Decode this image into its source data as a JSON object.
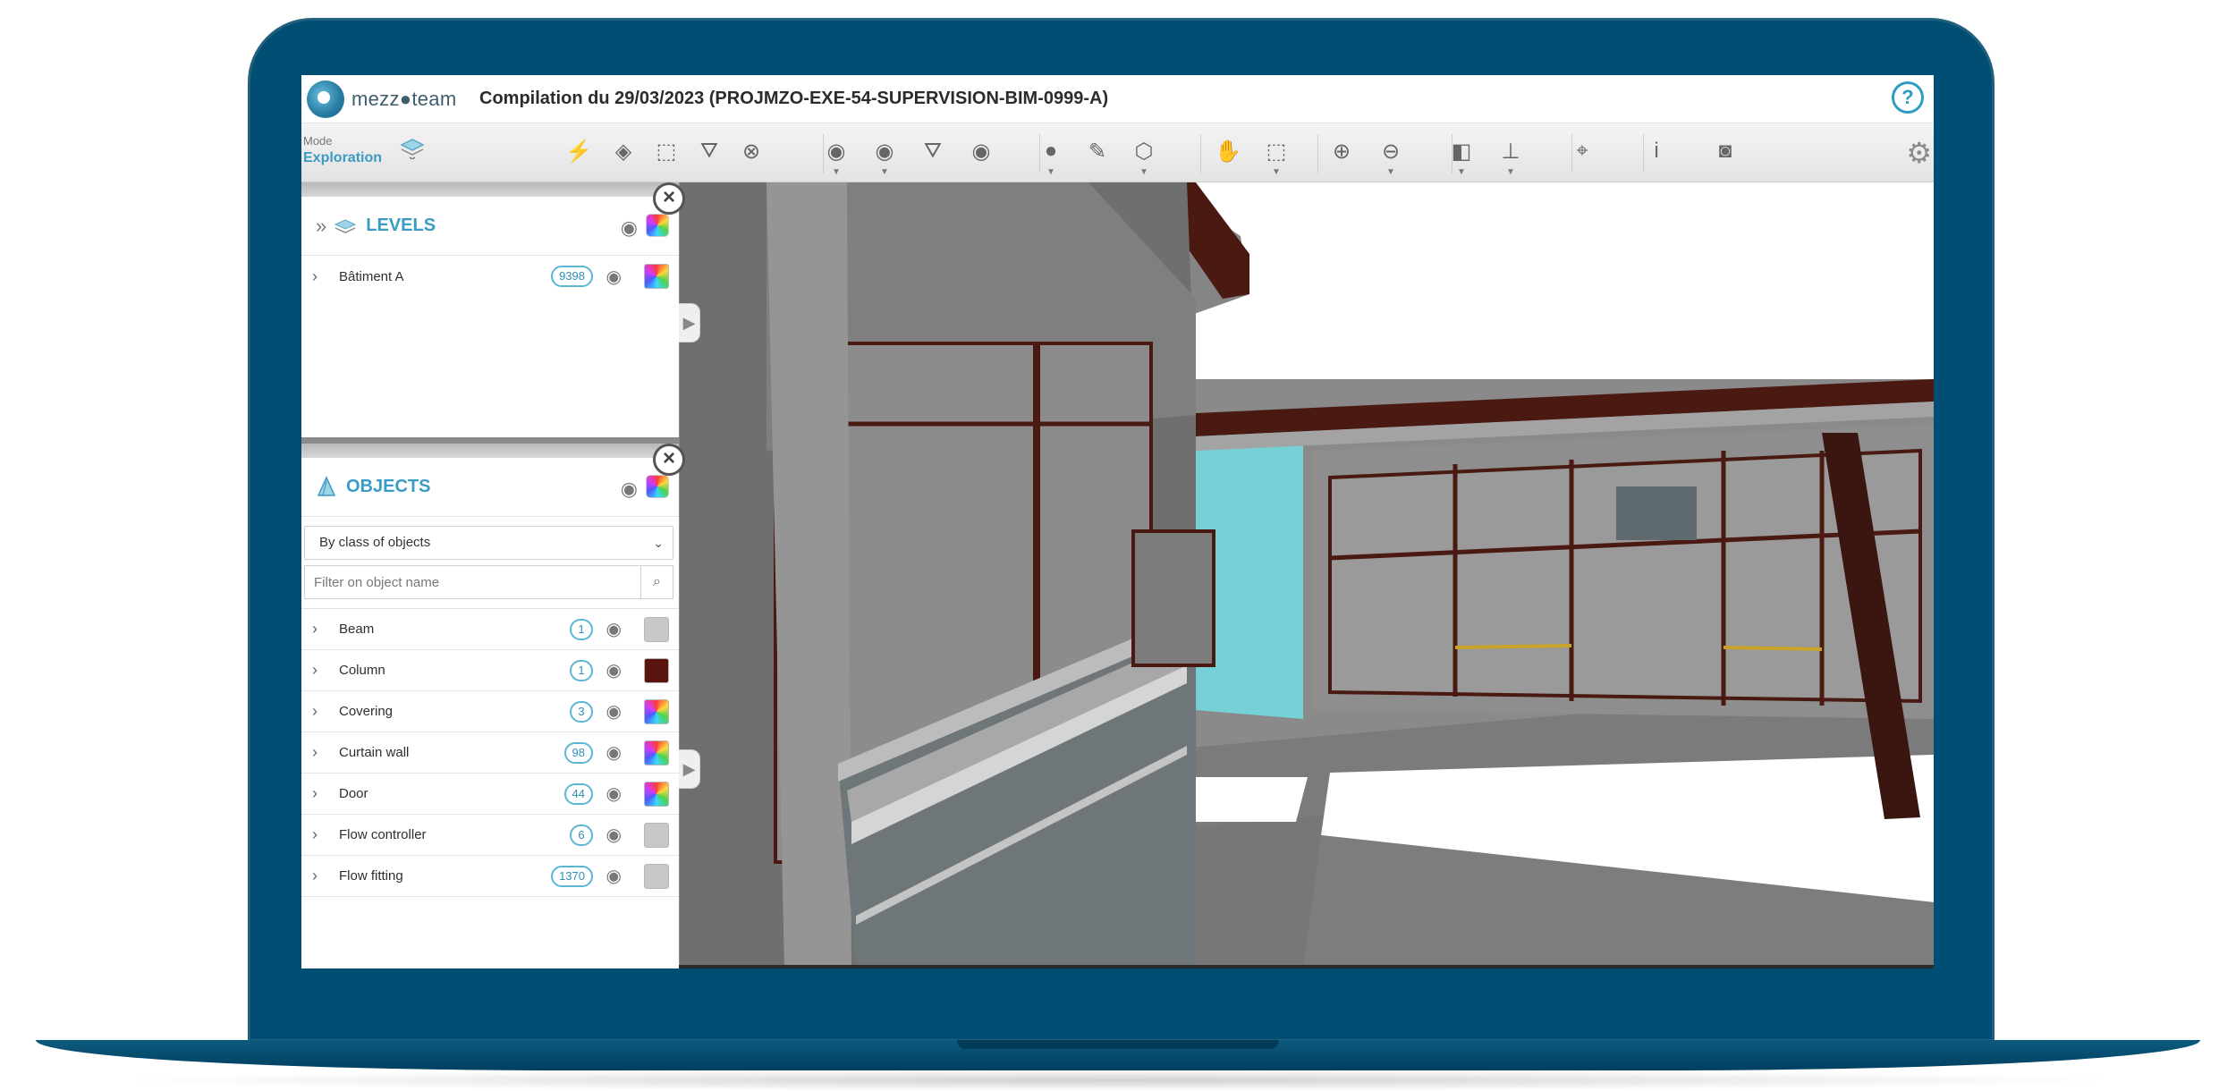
{
  "app": {
    "logo_text": "mezz●team",
    "project_title": "Compilation du 29/03/2023 (PROJMZO-EXE-54-SUPERVISION-BIM-0999-A)",
    "help_label": "?"
  },
  "toolbar": {
    "mode_label": "Mode",
    "mode_value": "Exploration",
    "tools": [
      {
        "name": "magic-select-icon",
        "glyph": "⚡"
      },
      {
        "name": "paint-select-icon",
        "glyph": "◈"
      },
      {
        "name": "select-area-icon",
        "glyph": "⬚"
      },
      {
        "name": "filter-icon",
        "glyph": "⛛"
      },
      {
        "name": "clear-selection-icon",
        "glyph": "⊗"
      },
      {
        "name": "visibility-icon",
        "glyph": "◉"
      },
      {
        "name": "show-icon",
        "glyph": "◉"
      },
      {
        "name": "filter-visibility-icon",
        "glyph": "⛛"
      },
      {
        "name": "reveal-icon",
        "glyph": "◉"
      },
      {
        "name": "material-sphere-icon",
        "glyph": "●"
      },
      {
        "name": "palette-icon",
        "glyph": "✎"
      },
      {
        "name": "view-cube-icon",
        "glyph": "⬡"
      },
      {
        "name": "pan-hand-icon",
        "glyph": "✋"
      },
      {
        "name": "section-box-icon",
        "glyph": "⬚"
      },
      {
        "name": "zoom-fit-icon",
        "glyph": "⊕"
      },
      {
        "name": "zoom-icon",
        "glyph": "⊖"
      },
      {
        "name": "explode-icon",
        "glyph": "◧"
      },
      {
        "name": "measure-icon",
        "glyph": "⊥"
      },
      {
        "name": "add-pin-icon",
        "glyph": "⌖"
      },
      {
        "name": "info-icon",
        "glyph": "i"
      },
      {
        "name": "camera-icon",
        "glyph": "◙"
      }
    ],
    "settings_glyph": "⚙"
  },
  "levels": {
    "title": "LEVELS",
    "items": [
      {
        "name": "Bâtiment A",
        "count": "9398"
      }
    ]
  },
  "objects": {
    "title": "OBJECTS",
    "group_by": "By class of objects",
    "filter_placeholder": "Filter on object name",
    "items": [
      {
        "name": "Beam",
        "count": "1",
        "color": "#c8c8c8"
      },
      {
        "name": "Column",
        "count": "1",
        "color": "#5a140d"
      },
      {
        "name": "Covering",
        "count": "3",
        "color": "rainbow"
      },
      {
        "name": "Curtain wall",
        "count": "98",
        "color": "rainbow"
      },
      {
        "name": "Door",
        "count": "44",
        "color": "rainbow"
      },
      {
        "name": "Flow controller",
        "count": "6",
        "color": "#c8c8c8"
      },
      {
        "name": "Flow fitting",
        "count": "1370",
        "color": "#c8c8c8"
      }
    ]
  },
  "colors": {
    "accent": "#3a9bc4",
    "frame": "#004e73",
    "glass": "#76d1d6",
    "steel": "#4a1a12"
  }
}
